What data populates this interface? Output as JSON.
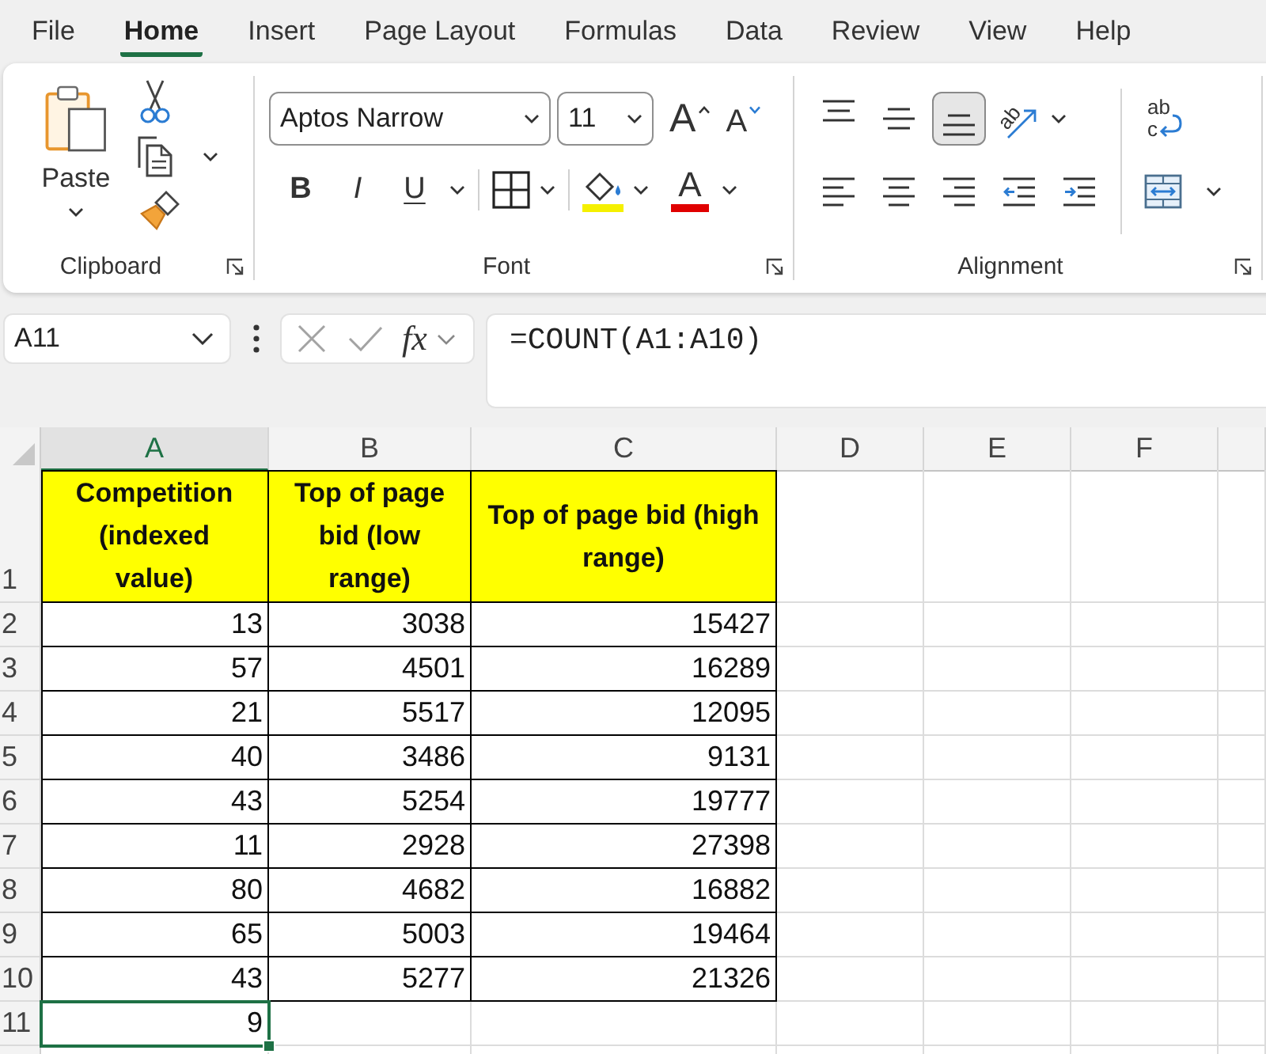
{
  "menu_tabs": [
    {
      "label": "File",
      "selected": false
    },
    {
      "label": "Home",
      "selected": true
    },
    {
      "label": "Insert",
      "selected": false
    },
    {
      "label": "Page Layout",
      "selected": false
    },
    {
      "label": "Formulas",
      "selected": false
    },
    {
      "label": "Data",
      "selected": false
    },
    {
      "label": "Review",
      "selected": false
    },
    {
      "label": "View",
      "selected": false
    },
    {
      "label": "Help",
      "selected": false
    }
  ],
  "ribbon": {
    "clipboard": {
      "paste_label": "Paste",
      "group_label": "Clipboard"
    },
    "font": {
      "font_name": "Aptos Narrow",
      "font_size": "11",
      "grow_font_label": "A",
      "shrink_font_label": "A",
      "style_buttons": [
        {
          "kind": "bold",
          "label": "B"
        },
        {
          "kind": "italic",
          "label": "I"
        },
        {
          "kind": "underline",
          "label": "U"
        }
      ],
      "font_color_label": "A",
      "group_label": "Font"
    },
    "alignment": {
      "vertical": [
        {
          "kind": "top",
          "selected": false
        },
        {
          "kind": "middle",
          "selected": false
        },
        {
          "kind": "bottom",
          "selected": true
        }
      ],
      "orientation_label": "ab",
      "horizontal": [
        {
          "kind": "left",
          "selected": false
        },
        {
          "kind": "center",
          "selected": false
        },
        {
          "kind": "right",
          "selected": false
        }
      ],
      "wrap_text_lines": [
        "ab",
        "c"
      ],
      "group_label": "Alignment"
    }
  },
  "formula_bar": {
    "name_box": "A11",
    "function_label": "fx",
    "formula": "=COUNT(A1:A10)"
  },
  "sheet": {
    "columns": [
      {
        "label": "A",
        "selected": true
      },
      {
        "label": "B",
        "selected": false
      },
      {
        "label": "C",
        "selected": false
      },
      {
        "label": "D",
        "selected": false
      },
      {
        "label": "E",
        "selected": false
      },
      {
        "label": "F",
        "selected": false
      }
    ],
    "rows": [
      {
        "number": "1",
        "kind": "header",
        "cells": [
          {
            "text": "Competition (indexed value)",
            "selected": false
          },
          {
            "text": "Top of page bid (low range)",
            "selected": false
          },
          {
            "text": "Top of page bid (high range)",
            "selected": false
          }
        ]
      },
      {
        "number": "2",
        "kind": "data",
        "cells": [
          {
            "text": "13",
            "selected": false
          },
          {
            "text": "3038",
            "selected": false
          },
          {
            "text": "15427",
            "selected": false
          }
        ]
      },
      {
        "number": "3",
        "kind": "data",
        "cells": [
          {
            "text": "57",
            "selected": false
          },
          {
            "text": "4501",
            "selected": false
          },
          {
            "text": "16289",
            "selected": false
          }
        ]
      },
      {
        "number": "4",
        "kind": "data",
        "cells": [
          {
            "text": "21",
            "selected": false
          },
          {
            "text": "5517",
            "selected": false
          },
          {
            "text": "12095",
            "selected": false
          }
        ]
      },
      {
        "number": "5",
        "kind": "data",
        "cells": [
          {
            "text": "40",
            "selected": false
          },
          {
            "text": "3486",
            "selected": false
          },
          {
            "text": "9131",
            "selected": false
          }
        ]
      },
      {
        "number": "6",
        "kind": "data",
        "cells": [
          {
            "text": "43",
            "selected": false
          },
          {
            "text": "5254",
            "selected": false
          },
          {
            "text": "19777",
            "selected": false
          }
        ]
      },
      {
        "number": "7",
        "kind": "data",
        "cells": [
          {
            "text": "11",
            "selected": false
          },
          {
            "text": "2928",
            "selected": false
          },
          {
            "text": "27398",
            "selected": false
          }
        ]
      },
      {
        "number": "8",
        "kind": "data",
        "cells": [
          {
            "text": "80",
            "selected": false
          },
          {
            "text": "4682",
            "selected": false
          },
          {
            "text": "16882",
            "selected": false
          }
        ]
      },
      {
        "number": "9",
        "kind": "data",
        "cells": [
          {
            "text": "65",
            "selected": false
          },
          {
            "text": "5003",
            "selected": false
          },
          {
            "text": "19464",
            "selected": false
          }
        ]
      },
      {
        "number": "10",
        "kind": "data",
        "cells": [
          {
            "text": "43",
            "selected": false
          },
          {
            "text": "5277",
            "selected": false
          },
          {
            "text": "21326",
            "selected": false
          }
        ]
      },
      {
        "number": "11",
        "kind": "plain",
        "cells": [
          {
            "text": "9",
            "selected": true
          }
        ]
      }
    ]
  }
}
